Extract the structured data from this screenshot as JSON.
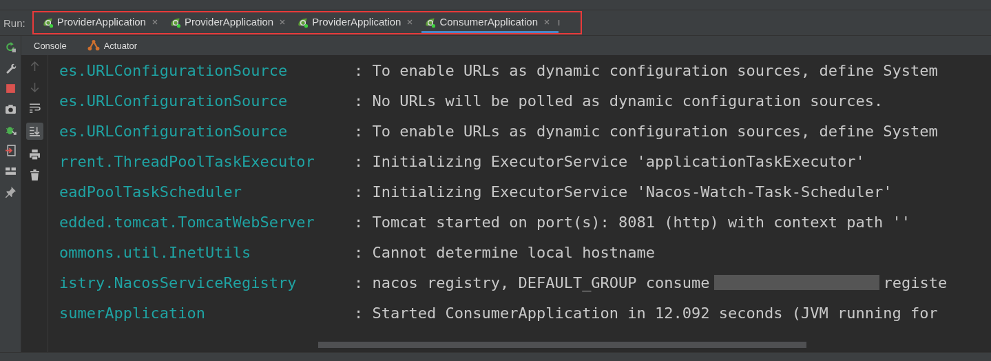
{
  "run_label": "Run:",
  "run_tabs": [
    {
      "label": "ProviderApplication",
      "selected": false
    },
    {
      "label": "ProviderApplication",
      "selected": false
    },
    {
      "label": "ProviderApplication",
      "selected": false
    },
    {
      "label": "ConsumerApplication",
      "selected": true
    }
  ],
  "tool_tabs": [
    {
      "label": "Console",
      "kind": "console"
    },
    {
      "label": "Actuator",
      "kind": "actuator"
    }
  ],
  "log_lines": [
    {
      "logger": "es.URLConfigurationSource",
      "message": ": To enable URLs as dynamic configuration sources, define System"
    },
    {
      "logger": "es.URLConfigurationSource",
      "message": ": No URLs will be polled as dynamic configuration sources."
    },
    {
      "logger": "es.URLConfigurationSource",
      "message": ": To enable URLs as dynamic configuration sources, define System"
    },
    {
      "logger": "rrent.ThreadPoolTaskExecutor",
      "message": ": Initializing ExecutorService 'applicationTaskExecutor'"
    },
    {
      "logger": "eadPoolTaskScheduler",
      "message": ": Initializing ExecutorService 'Nacos-Watch-Task-Scheduler'"
    },
    {
      "logger": "edded.tomcat.TomcatWebServer",
      "message": ": Tomcat started on port(s): 8081 (http) with context path ''"
    },
    {
      "logger": "ommons.util.InetUtils",
      "message": ": Cannot determine local hostname"
    },
    {
      "logger": "istry.NacosServiceRegistry",
      "message": ": nacos registry, DEFAULT_GROUP consume",
      "redacted_tail": "registe"
    },
    {
      "logger": "sumerApplication",
      "message": ": Started ConsumerApplication in 12.092 seconds (JVM running for"
    }
  ]
}
